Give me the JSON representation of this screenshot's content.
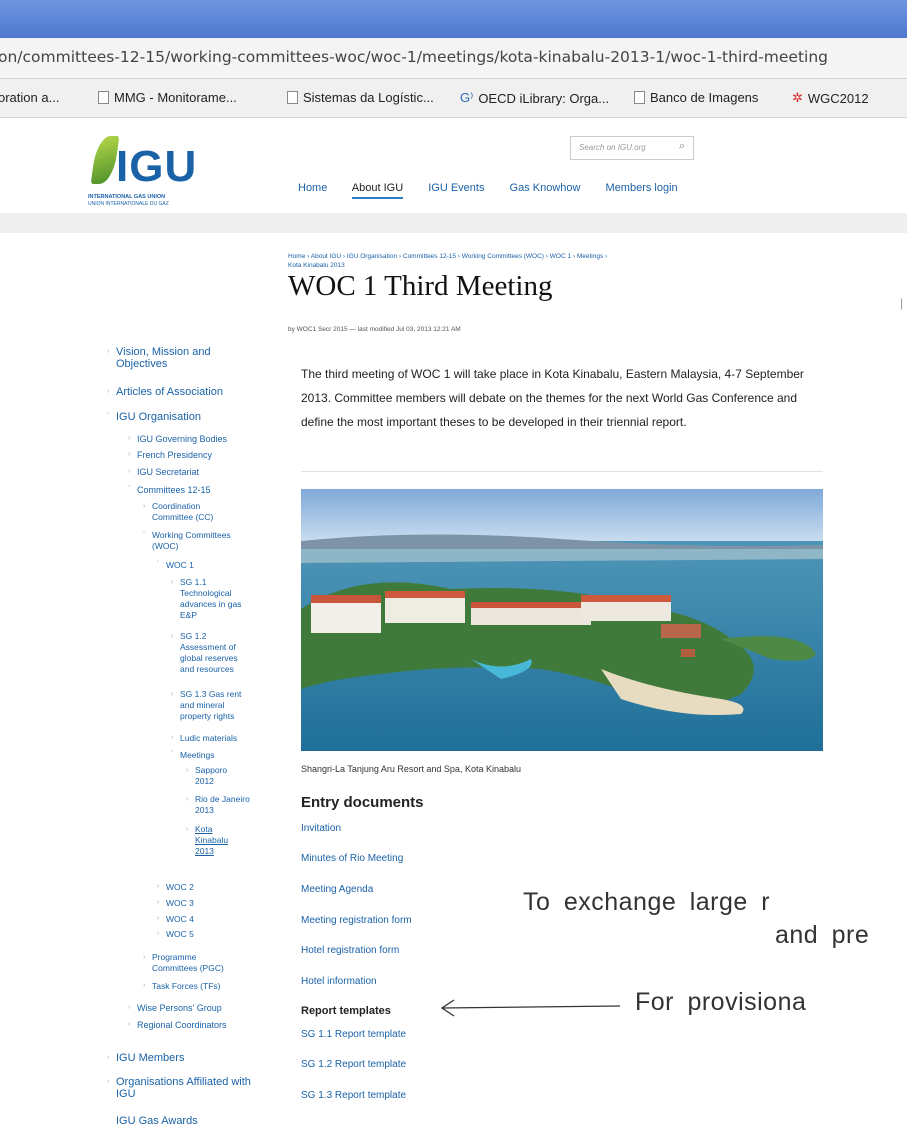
{
  "browser": {
    "url": "on/committees-12-15/working-committees-woc/woc-1/meetings/kota-kinabalu-2013-1/woc-1-third-meeting",
    "bookmarks": [
      {
        "label": "oration a...",
        "icon": "none"
      },
      {
        "label": "MMG - Monitorame...",
        "icon": "page-icon"
      },
      {
        "label": "Sistemas da Logístic...",
        "icon": "page-icon"
      },
      {
        "label": "OECD iLibrary: Orga...",
        "icon": "oecd-icon"
      },
      {
        "label": "Banco de Imagens",
        "icon": "page-icon"
      },
      {
        "label": "WGC2012",
        "icon": "wgc-icon"
      }
    ]
  },
  "site": {
    "logo": {
      "text": "IGU",
      "line1": "INTERNATIONAL GAS UNION",
      "line2": "UNION INTERNATIONALE DU GAZ"
    },
    "search_placeholder": "Search on IGU.org",
    "nav": [
      "Home",
      "About IGU",
      "IGU Events",
      "Gas Knowhow",
      "Members login"
    ],
    "nav_active": "About IGU",
    "breadcrumb_line1": "Home  ›  About IGU  ›  IGU Organisation  ›  Committees 12-15  ›  Working Committees (WOC)  ›  WOC 1  ›  Meetings  ›",
    "breadcrumb_line2": "Kota Kinabalu 2013",
    "page_title": "WOC 1 Third Meeting",
    "byline": "by WOC1 Secr 2015 — last modified Jul 03, 2013 12:21 AM",
    "body_text": "The third meeting of WOC 1 will take place in Kota Kinabalu, Eastern Malaysia, 4-7 September 2013. Committee members will debate on the themes for the next World Gas Conference and define the most important theses to be developed in their triennial report.",
    "photo_caption": "Shangri-La Tanjung Aru Resort and Spa, Kota Kinabalu",
    "entry_heading": "Entry documents",
    "documents": [
      "Invitation",
      "Minutes of Rio Meeting",
      "Meeting Agenda",
      "Meeting registration form",
      "Hotel registration form",
      "Hotel information"
    ],
    "report_heading": "Report templates",
    "reports": [
      "SG 1.1 Report template",
      "SG 1.2 Report template",
      "SG 1.3 Report template"
    ]
  },
  "sidebar": {
    "vision": "Vision, Mission and Objectives",
    "articles": "Articles of Association",
    "org": "IGU Organisation",
    "governing": "IGU Governing Bodies",
    "french": "French Presidency",
    "secretariat": "IGU Secretariat",
    "committees": "Committees 12-15",
    "coord": "Coordination Committee (CC)",
    "woc": "Working Committees (WOC)",
    "woc1": "WOC 1",
    "sg11": "SG 1.1 Technological advances in gas E&P",
    "sg12": "SG 1.2 Assessment of global reserves and resources",
    "sg13": "SG 1.3 Gas rent and mineral property rights",
    "ludic": "Ludic materials",
    "meetings": "Meetings",
    "sapporo": "Sapporo 2012",
    "rio": "Rio de Janeiro 2013",
    "kota": "Kota Kinabalu 2013",
    "woc2": "WOC 2",
    "woc3": "WOC 3",
    "woc4": "WOC 4",
    "woc5": "WOC 5",
    "pgc": "Programme Committees (PGC)",
    "tf": "Task Forces (TFs)",
    "wise": "Wise Persons' Group",
    "regional": "Regional Coordinators",
    "members": "IGU Members",
    "affiliated": "Organisations Affiliated with IGU",
    "awards": "IGU Gas Awards"
  },
  "overlay": {
    "line1": "To exchange large r",
    "line2": "and pre",
    "line3": "For provisiona"
  }
}
